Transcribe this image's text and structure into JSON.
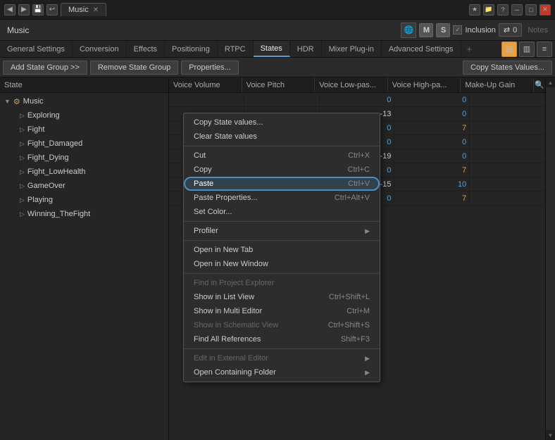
{
  "titlebar": {
    "back_label": "◀",
    "forward_label": "▶",
    "save_label": "💾",
    "tab_label": "Music",
    "close_label": "✕",
    "star_label": "★",
    "folder_label": "📁",
    "help_label": "?",
    "minimize_label": "─",
    "maximize_label": "□",
    "close_win_label": "✕"
  },
  "toolbar": {
    "title": "Music",
    "m_label": "M",
    "s_label": "S",
    "inclusion_label": "Inclusion",
    "share_count": "0",
    "notes_label": "Notes"
  },
  "tabs": [
    {
      "id": "general",
      "label": "General Settings"
    },
    {
      "id": "conversion",
      "label": "Conversion"
    },
    {
      "id": "effects",
      "label": "Effects"
    },
    {
      "id": "positioning",
      "label": "Positioning"
    },
    {
      "id": "rtpc",
      "label": "RTPC"
    },
    {
      "id": "states",
      "label": "States",
      "active": true
    },
    {
      "id": "hdr",
      "label": "HDR"
    },
    {
      "id": "mixer",
      "label": "Mixer Plug-in"
    },
    {
      "id": "advanced",
      "label": "Advanced Settings"
    },
    {
      "id": "plus",
      "label": "+"
    }
  ],
  "action_bar": {
    "add_label": "Add State Group >>",
    "remove_label": "Remove State Group",
    "properties_label": "Properties...",
    "copy_states_label": "Copy States Values..."
  },
  "columns": {
    "state": "State",
    "voice_volume": "Voice Volume",
    "voice_pitch": "Voice Pitch",
    "voice_low_pass": "Voice Low-pas...",
    "voice_high_pass": "Voice High-pa...",
    "make_up_gain": "Make-Up Gain"
  },
  "tree": {
    "group_label": "Music",
    "items": [
      {
        "label": "Exploring"
      },
      {
        "label": "Fight"
      },
      {
        "label": "Fight_Damaged"
      },
      {
        "label": "Fight_Dying"
      },
      {
        "label": "Fight_LowHealth"
      },
      {
        "label": "GameOver"
      },
      {
        "label": "Playing"
      },
      {
        "label": "Winning_TheFight"
      }
    ]
  },
  "data_rows": [
    {
      "vol": "",
      "pitch": "",
      "lp": "0",
      "hp": "0",
      "mug": ""
    },
    {
      "vol": "",
      "pitch": "",
      "lp": "-13",
      "hp": "0",
      "mug": ""
    },
    {
      "vol": "",
      "pitch": "",
      "lp": "0",
      "hp": "7",
      "mug": ""
    },
    {
      "vol": "",
      "pitch": "",
      "lp": "0",
      "hp": "0",
      "mug": ""
    },
    {
      "vol": "",
      "pitch": "",
      "lp": "-19",
      "hp": "0",
      "mug": ""
    },
    {
      "vol": "",
      "pitch": "",
      "lp": "0",
      "hp": "7",
      "mug": ""
    },
    {
      "vol": "",
      "pitch": "",
      "lp": "-15",
      "hp": "10",
      "mug": ""
    },
    {
      "vol": "",
      "pitch": "",
      "lp": "0",
      "hp": "7",
      "mug": ""
    }
  ],
  "context_menu": {
    "items": [
      {
        "id": "copy-state-values",
        "label": "Copy State values...",
        "shortcut": "",
        "type": "normal"
      },
      {
        "id": "clear-state-values",
        "label": "Clear State values",
        "shortcut": "",
        "type": "normal"
      },
      {
        "id": "sep1",
        "type": "separator"
      },
      {
        "id": "cut",
        "label": "Cut",
        "shortcut": "Ctrl+X",
        "type": "normal"
      },
      {
        "id": "copy",
        "label": "Copy",
        "shortcut": "Ctrl+C",
        "type": "normal"
      },
      {
        "id": "paste",
        "label": "Paste",
        "shortcut": "Ctrl+V",
        "type": "highlighted"
      },
      {
        "id": "paste-props",
        "label": "Paste Properties...",
        "shortcut": "Ctrl+Alt+V",
        "type": "normal"
      },
      {
        "id": "set-color",
        "label": "Set Color...",
        "shortcut": "",
        "type": "normal"
      },
      {
        "id": "sep2",
        "type": "separator"
      },
      {
        "id": "profiler",
        "label": "Profiler",
        "shortcut": "",
        "type": "submenu"
      },
      {
        "id": "sep3",
        "type": "separator"
      },
      {
        "id": "open-new-tab",
        "label": "Open in New Tab",
        "shortcut": "",
        "type": "normal"
      },
      {
        "id": "open-new-window",
        "label": "Open in New Window",
        "shortcut": "",
        "type": "normal"
      },
      {
        "id": "sep4",
        "type": "separator"
      },
      {
        "id": "find-section",
        "label": "Find in Project Explorer",
        "shortcut": "",
        "type": "section"
      },
      {
        "id": "show-list-view",
        "label": "Show in List View",
        "shortcut": "Ctrl+Shift+L",
        "type": "normal"
      },
      {
        "id": "show-multi-editor",
        "label": "Show in Multi Editor",
        "shortcut": "Ctrl+M",
        "type": "normal"
      },
      {
        "id": "show-schematic",
        "label": "Show in Schematic View",
        "shortcut": "Ctrl+Shift+S",
        "type": "disabled"
      },
      {
        "id": "find-refs",
        "label": "Find All References",
        "shortcut": "Shift+F3",
        "type": "normal"
      },
      {
        "id": "sep5",
        "type": "separator"
      },
      {
        "id": "edit-external",
        "label": "Edit in External Editor",
        "shortcut": "",
        "type": "submenu-disabled"
      },
      {
        "id": "open-folder",
        "label": "Open Containing Folder",
        "shortcut": "",
        "type": "submenu"
      }
    ]
  }
}
